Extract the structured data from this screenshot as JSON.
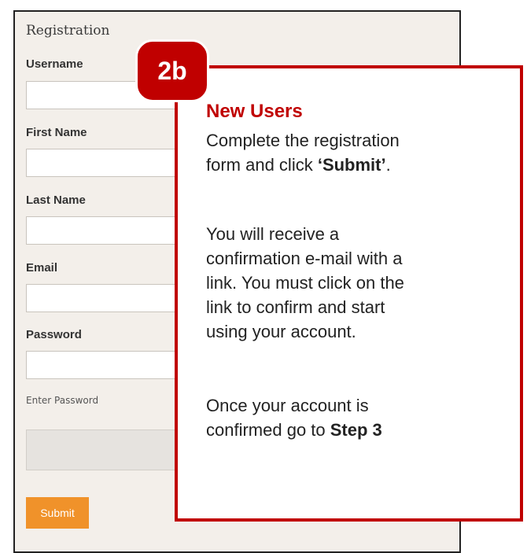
{
  "form": {
    "title": "Registration",
    "fields": [
      {
        "label": "Username",
        "value": "",
        "placeholder": ""
      },
      {
        "label": "First Name",
        "value": "",
        "placeholder": ""
      },
      {
        "label": "Last Name",
        "value": "",
        "placeholder": ""
      },
      {
        "label": "Email",
        "value": "",
        "placeholder": ""
      },
      {
        "label": "Password",
        "value": "",
        "placeholder": ""
      }
    ],
    "password_helper": "Enter Password",
    "submit_label": "Submit"
  },
  "callout": {
    "badge": "2b",
    "title": "New Users",
    "p1_line1": "Complete the registration",
    "p1_line2_prefix": "form and click ",
    "p1_line2_bold": "‘Submit’",
    "p1_line2_suffix": ".",
    "p2_line1": "You will receive a",
    "p2_line2": "confirmation e-mail with a",
    "p2_line3": "link. You must click on the",
    "p2_line4": "link to confirm and start",
    "p2_line5": "using your account.",
    "p3_line1": "Once your account is",
    "p3_line2_prefix": "confirmed go to ",
    "p3_line2_bold": "Step 3"
  },
  "colors": {
    "accent_red": "#c00000",
    "submit_orange": "#f0922a",
    "panel_bg": "#f3efea"
  }
}
